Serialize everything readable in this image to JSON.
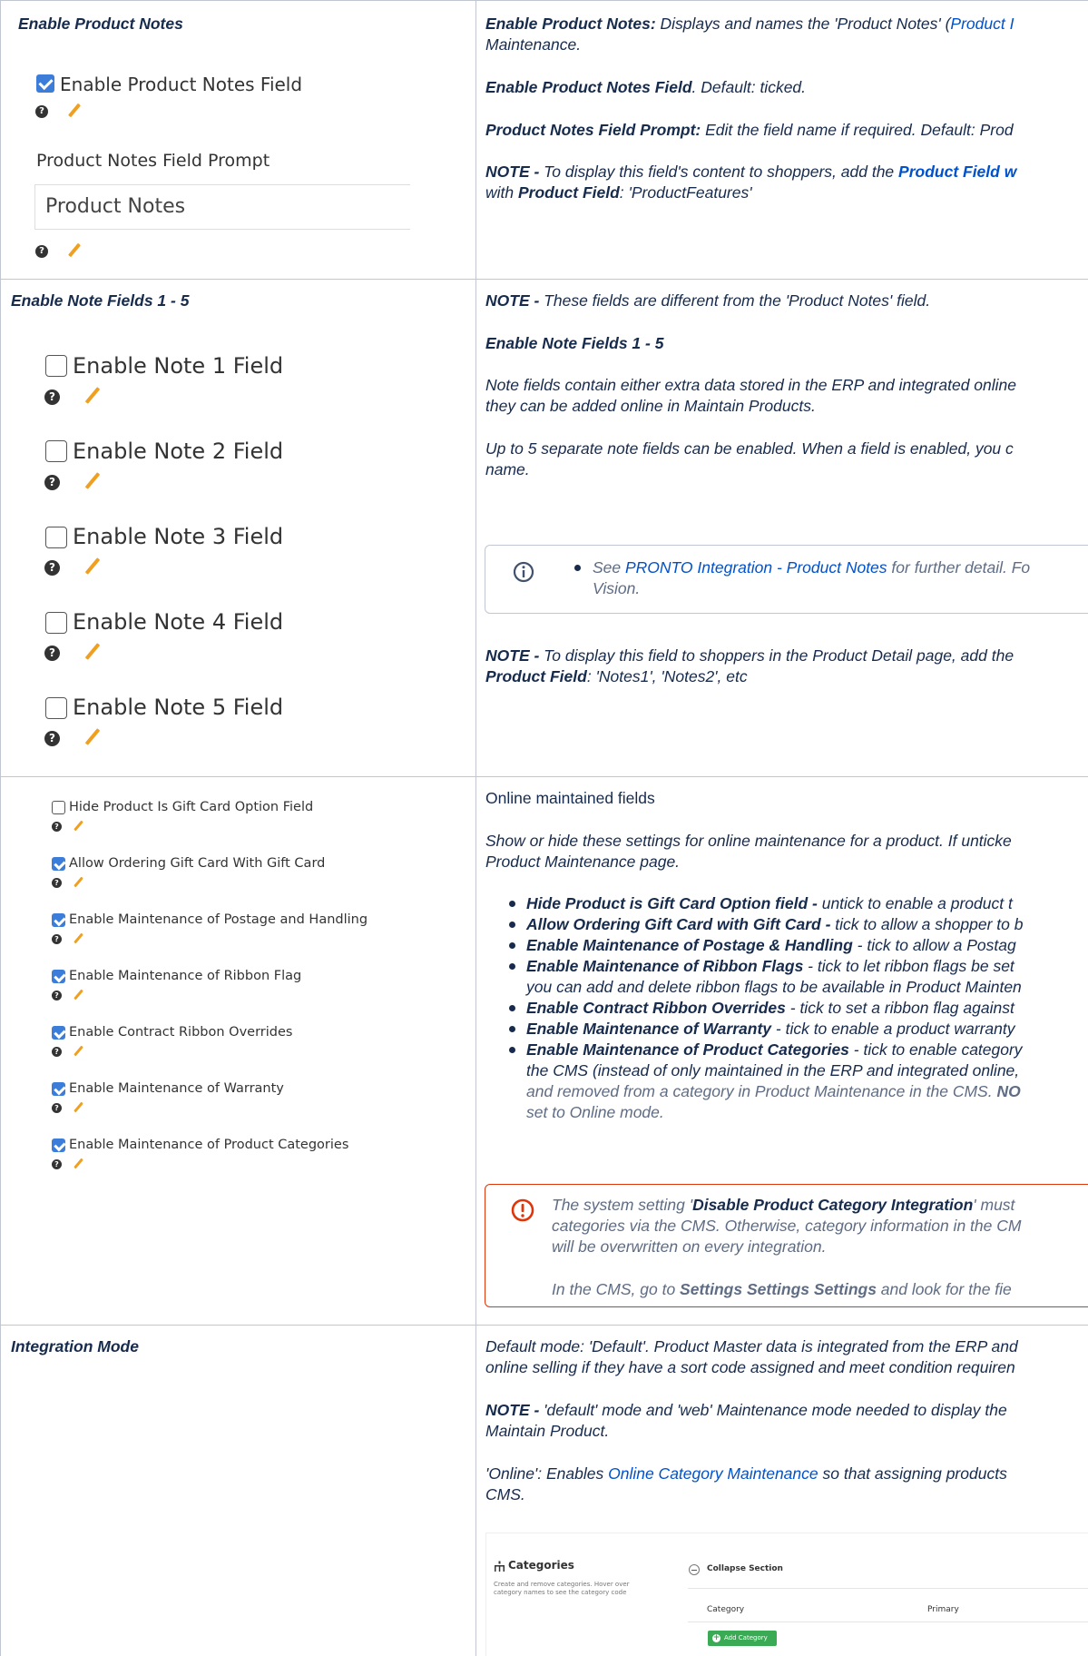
{
  "row1": {
    "title": "Enable Product Notes",
    "ui": {
      "cb_label": "Enable Product Notes Field",
      "prompt_label": "Product Notes Field Prompt",
      "prompt_value": "Product Notes"
    },
    "d1_b": "Enable Product Notes:",
    "d1_t": " Displays and names the 'Product Notes' (",
    "d1_link": "Product I",
    "d1_l2": "Maintenance.",
    "d2_b": "Enable Product Notes Field",
    "d2_t": ". Default: ticked.",
    "d3_b": "Product Notes Field Prompt:",
    "d3_t": " Edit the field name if required. Default: Prod",
    "d4_b": "NOTE -",
    "d4_t": " To display this field's content to shoppers, add the ",
    "d4_link": "Product Field w",
    "d4_l2a": "with ",
    "d4_l2b": "Product Field",
    "d4_l2c": ": 'ProductFeatures'"
  },
  "row2": {
    "title": "Enable Note Fields 1 - 5",
    "ui": {
      "note1": "Enable Note 1 Field",
      "note2": "Enable Note 2 Field",
      "note3": "Enable Note 3 Field",
      "note4": "Enable Note 4 Field",
      "note5": "Enable Note 5 Field"
    },
    "n1_b": "NOTE -",
    "n1_t": " These fields are different from the 'Product Notes' field.",
    "h2": "Enable Note Fields 1 - 5",
    "p1a": "Note fields contain either extra data stored in the ERP and integrated online",
    "p1b": "they can be added online in Maintain Products.",
    "p2a": "Up to 5 separate note fields can be enabled. When a field is enabled, you c",
    "p2b": "name.",
    "info_pre": "See ",
    "info_link": "PRONTO Integration - Product Notes",
    "info_post": " for further detail. Fo",
    "info_l2": "Vision.",
    "n2_b": "NOTE -",
    "n2_t": " To display this field to shoppers in the Product Detail page, add the",
    "n2_l2b": "Product Field",
    "n2_l2t": ": 'Notes1', 'Notes2', etc"
  },
  "row3": {
    "ui": {
      "c1": "Hide Product Is Gift Card Option Field",
      "c2": "Allow Ordering Gift Card With Gift Card",
      "c3": "Enable Maintenance of Postage and Handling",
      "c4": "Enable Maintenance of Ribbon Flag",
      "c5": "Enable Contract Ribbon Overrides",
      "c6": "Enable Maintenance of Warranty",
      "c7": "Enable Maintenance of Product Categories"
    },
    "heading": "Online maintained fields",
    "p1a": "Show or hide these settings for online maintenance for a product. If unticke",
    "p1b": "Product Maintenance page.",
    "b1b": "Hide Product is Gift Card Option field -",
    "b1t": "  untick to enable a product t",
    "b2b": "Allow Ordering Gift Card with Gift Card -",
    "b2t": " tick to allow a shopper to b",
    "b3b": "Enable Maintenance of Postage & Handling",
    "b3t": " - tick to allow a Postag",
    "b4b": "Enable Maintenance of Ribbon Flags",
    "b4t": " - tick to let ribbon flags be set",
    "b4l2": "you can add and delete ribbon flags to be available in Product Mainten",
    "b5b": "Enable Contract Ribbon Overrides",
    "b5t": " - tick to set a ribbon flag against",
    "b6b": "Enable Maintenance of Warranty",
    "b6t": " - tick to enable a product warranty",
    "b7b": "Enable Maintenance of Product Categories",
    "b7t": " - tick to enable category",
    "b7l2": "the CMS (instead of only maintained in the ERP and integrated online,",
    "b7l3a": "and removed from a category in Product Maintenance in the CMS. ",
    "b7l3b": "NO",
    "b7l4": "set to Online mode.",
    "e1a": "The system setting '",
    "e1b": "Disable Product Category Integration",
    "e1c": "' must",
    "e2": "categories via the CMS. Otherwise, category information in the CM",
    "e3": "will be overwritten on every integration.",
    "e4a": "In the CMS, go to ",
    "e4b": "Settings",
    "e4c": "  ",
    "e4d": "Settings",
    "e4e": "  ",
    "e4f": "Settings",
    "e4g": " and look for the fie"
  },
  "row4": {
    "title": "Integration Mode",
    "p1a": "Default mode: 'Default'. Product Master data is integrated from the ERP and",
    "p1b": "online selling if they have a sort code assigned and meet condition requiren",
    "n_b": "NOTE -",
    "n_t": " 'default' mode and 'web' Maintenance mode needed to display the",
    "n_l2": "Maintain Product.",
    "o_pre": "'Online': Enables ",
    "o_link": "Online Category Maintenance",
    "o_post": " so that assigning products",
    "o_l2": "CMS.",
    "shot": {
      "title": "Categories",
      "desc1": "Create and remove categories. Hover over",
      "desc2": "category names to see the category code",
      "collapse": "Collapse Section",
      "col1": "Category",
      "col2": "Primary",
      "add": "Add Category"
    }
  },
  "colors": {
    "accent": "#3b7dd8",
    "link": "#0052cc",
    "error": "#de350b",
    "add_button": "#3aaa55"
  }
}
